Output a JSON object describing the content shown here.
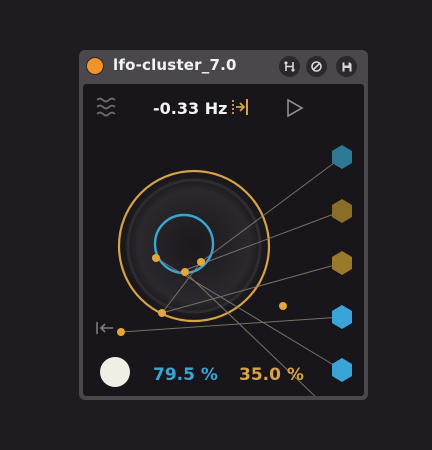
{
  "device": {
    "title": "lfo-cluster_7.0",
    "frequency": "-0.33 Hz",
    "depth_percent": "79.5 %",
    "offset_percent": "35.0 %"
  },
  "icons": {
    "power": "power-toggle",
    "route": "route-icon",
    "hotswap": "hotswap-icon",
    "save": "save-icon",
    "waveform": "waveform-icon",
    "sync": "tempo-sync-icon",
    "play": "play-icon",
    "retrigger": "retrigger-icon"
  },
  "colors": {
    "accent_orange": "#f0932a",
    "gold": "#d6a347",
    "blue": "#39a6d4",
    "outputs": [
      "#2e7a96",
      "#8a6d27",
      "#9a7a2a",
      "#3aa3d8",
      "#3aa3d8",
      "#2a6e88"
    ]
  }
}
